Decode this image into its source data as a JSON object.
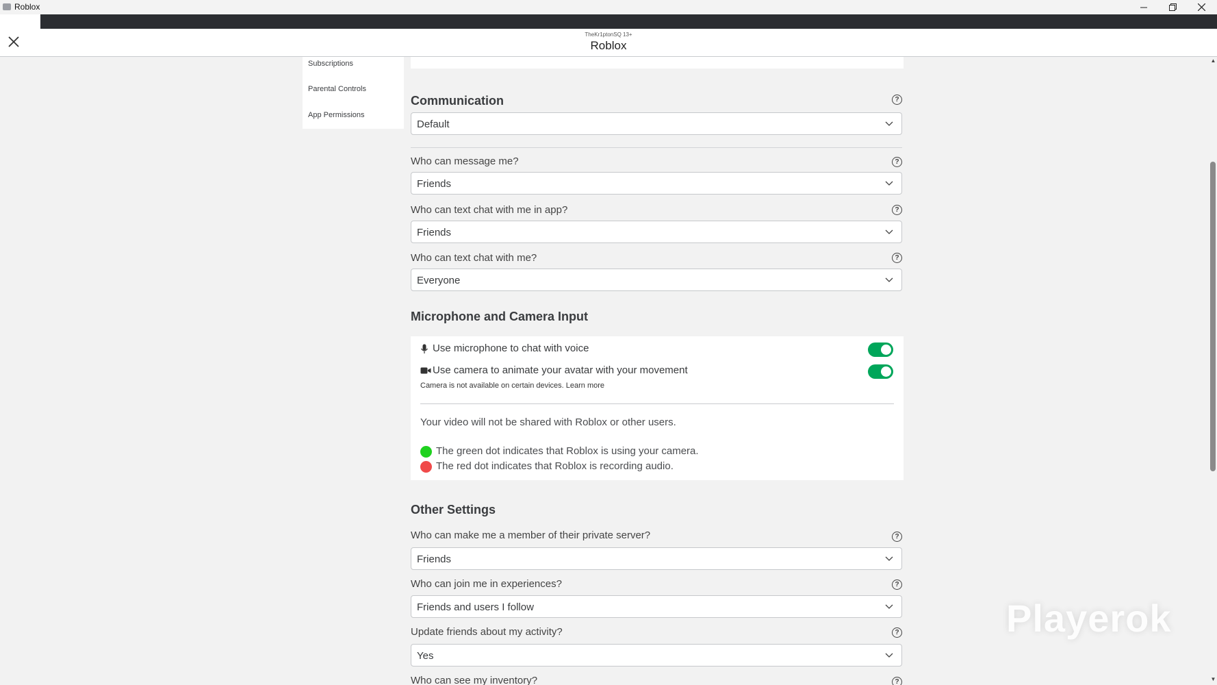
{
  "window": {
    "title": "Roblox"
  },
  "header": {
    "subtitle": "TheKr1ptonSQ 13+",
    "title": "Roblox"
  },
  "sidebar": {
    "items": [
      {
        "label": "Subscriptions"
      },
      {
        "label": "Parental Controls"
      },
      {
        "label": "App Permissions"
      }
    ]
  },
  "communication": {
    "title": "Communication",
    "preset_value": "Default",
    "fields": [
      {
        "label": "Who can message me?",
        "value": "Friends"
      },
      {
        "label": "Who can text chat with me in app?",
        "value": "Friends"
      },
      {
        "label": "Who can text chat with me?",
        "value": "Everyone"
      }
    ]
  },
  "mic_camera": {
    "title": "Microphone and Camera Input",
    "mic_label": "Use microphone to chat with voice",
    "mic_enabled": true,
    "camera_label": "Use camera to animate your avatar with your movement",
    "camera_enabled": true,
    "camera_note": "Camera is not available on certain devices. Learn more",
    "privacy_note": "Your video will not be shared with Roblox or other users.",
    "green_dot_text": "The green dot indicates that Roblox is using your camera.",
    "red_dot_text": "The red dot indicates that Roblox is recording audio.",
    "colors": {
      "toggle_on": "#00a65a",
      "green_dot": "#1fd11f",
      "red_dot": "#f04a4a"
    }
  },
  "other": {
    "title": "Other Settings",
    "fields": [
      {
        "label": "Who can make me a member of their private server?",
        "value": "Friends"
      },
      {
        "label": "Who can join me in experiences?",
        "value": "Friends and users I follow"
      },
      {
        "label": "Update friends about my activity?",
        "value": "Yes"
      },
      {
        "label": "Who can see my inventory?"
      }
    ]
  },
  "watermark": "Playerok"
}
